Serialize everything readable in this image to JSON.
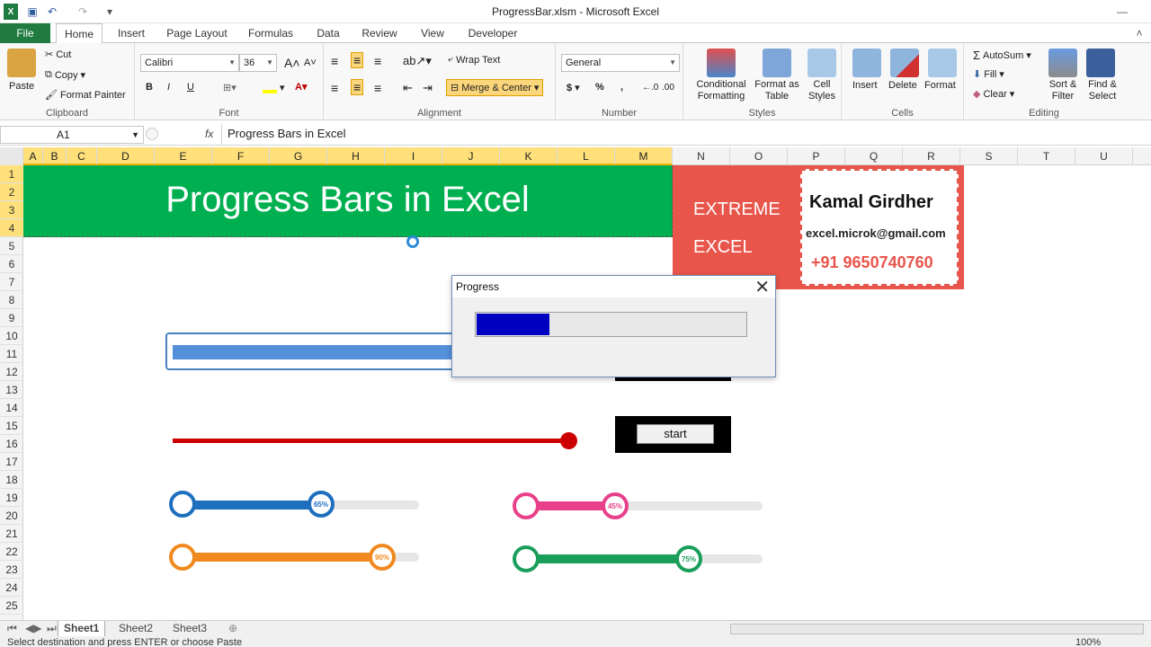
{
  "window": {
    "title": "ProgressBar.xlsm  -  Microsoft Excel"
  },
  "tabs": [
    "File",
    "Home",
    "Insert",
    "Page Layout",
    "Formulas",
    "Data",
    "Review",
    "View",
    "Developer"
  ],
  "clipboard": {
    "paste": "Paste",
    "cut": "Cut",
    "copy": "Copy",
    "format_painter": "Format Painter",
    "label": "Clipboard"
  },
  "font": {
    "name": "Calibri",
    "size": "36",
    "bold": "B",
    "italic": "I",
    "underline": "U",
    "label": "Font"
  },
  "alignment": {
    "wrap": "Wrap Text",
    "merge": "Merge & Center",
    "label": "Alignment"
  },
  "number": {
    "format": "General",
    "currency": "$",
    "percent": "%",
    "comma": ",",
    "label": "Number"
  },
  "styles": {
    "cond": "Conditional Formatting",
    "table": "Format as Table",
    "cell": "Cell Styles",
    "label": "Styles"
  },
  "cells": {
    "insert": "Insert",
    "delete": "Delete",
    "format": "Format",
    "label": "Cells"
  },
  "editing": {
    "autosum": "AutoSum",
    "fill": "Fill",
    "clear": "Clear",
    "sort": "Sort & Filter",
    "find": "Find & Select",
    "label": "Editing"
  },
  "formula_bar": {
    "name_box": "A1",
    "fx": "fx",
    "content": "Progress Bars in Excel"
  },
  "columns": [
    "A",
    "B",
    "C",
    "D",
    "E",
    "F",
    "G",
    "H",
    "I",
    "J",
    "K",
    "L",
    "M",
    "N",
    "O",
    "P",
    "Q",
    "R",
    "S",
    "T",
    "U"
  ],
  "rows": [
    "1",
    "2",
    "3",
    "4",
    "5",
    "6",
    "7",
    "8",
    "9",
    "10",
    "11",
    "12",
    "13",
    "14",
    "15",
    "16",
    "17",
    "18",
    "19",
    "20",
    "21",
    "22",
    "23",
    "24",
    "25"
  ],
  "banner": {
    "title": "Progress Bars in Excel"
  },
  "card": {
    "line1": "EXTREME",
    "line2": "EXCEL",
    "name": "Kamal Girdher",
    "email": "excel.microk@gmail.com",
    "phone": "+91 9650740760"
  },
  "dialog": {
    "title": "Progress",
    "close": "✕",
    "progress": 0.27
  },
  "start_button": "start",
  "bars": {
    "blue": "65%",
    "pink": "45%",
    "orange": "90%",
    "green": "75%"
  },
  "sheets": [
    "Sheet1",
    "Sheet2",
    "Sheet3"
  ],
  "status": "Select destination and press ENTER or choose Paste",
  "zoom": "100%"
}
